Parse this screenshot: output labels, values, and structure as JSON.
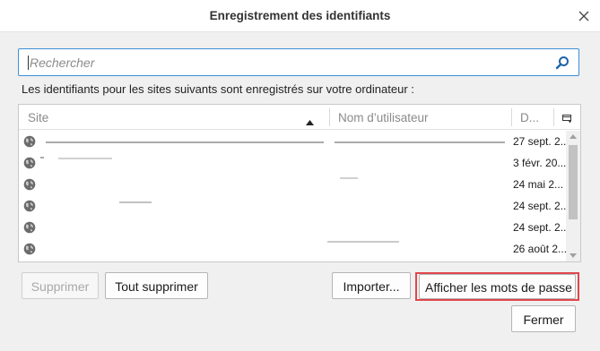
{
  "dialog": {
    "title": "Enregistrement des identifiants"
  },
  "search": {
    "placeholder": "Rechercher",
    "value": ""
  },
  "info_text": "Les identifiants pour les sites suivants sont enregistrés sur votre ordinateur :",
  "table": {
    "columns": [
      "Site",
      "Nom d’utilisateur",
      "D..."
    ],
    "sort": {
      "column": "Site",
      "direction": "ascending"
    },
    "rows": [
      {
        "date": "27 sept. 2..."
      },
      {
        "date": "3 févr. 20..."
      },
      {
        "date": "24 mai 2..."
      },
      {
        "date": "24 sept. 2..."
      },
      {
        "date": "24 sept. 2..."
      },
      {
        "date": "26 août 2..."
      }
    ]
  },
  "buttons": {
    "delete": "Supprimer",
    "delete_all": "Tout supprimer",
    "import": "Importer...",
    "show_passwords": "Afficher les mots de passe",
    "close": "Fermer"
  },
  "colors": {
    "accent": "#3c8fd6",
    "highlight": "#e0474c"
  }
}
